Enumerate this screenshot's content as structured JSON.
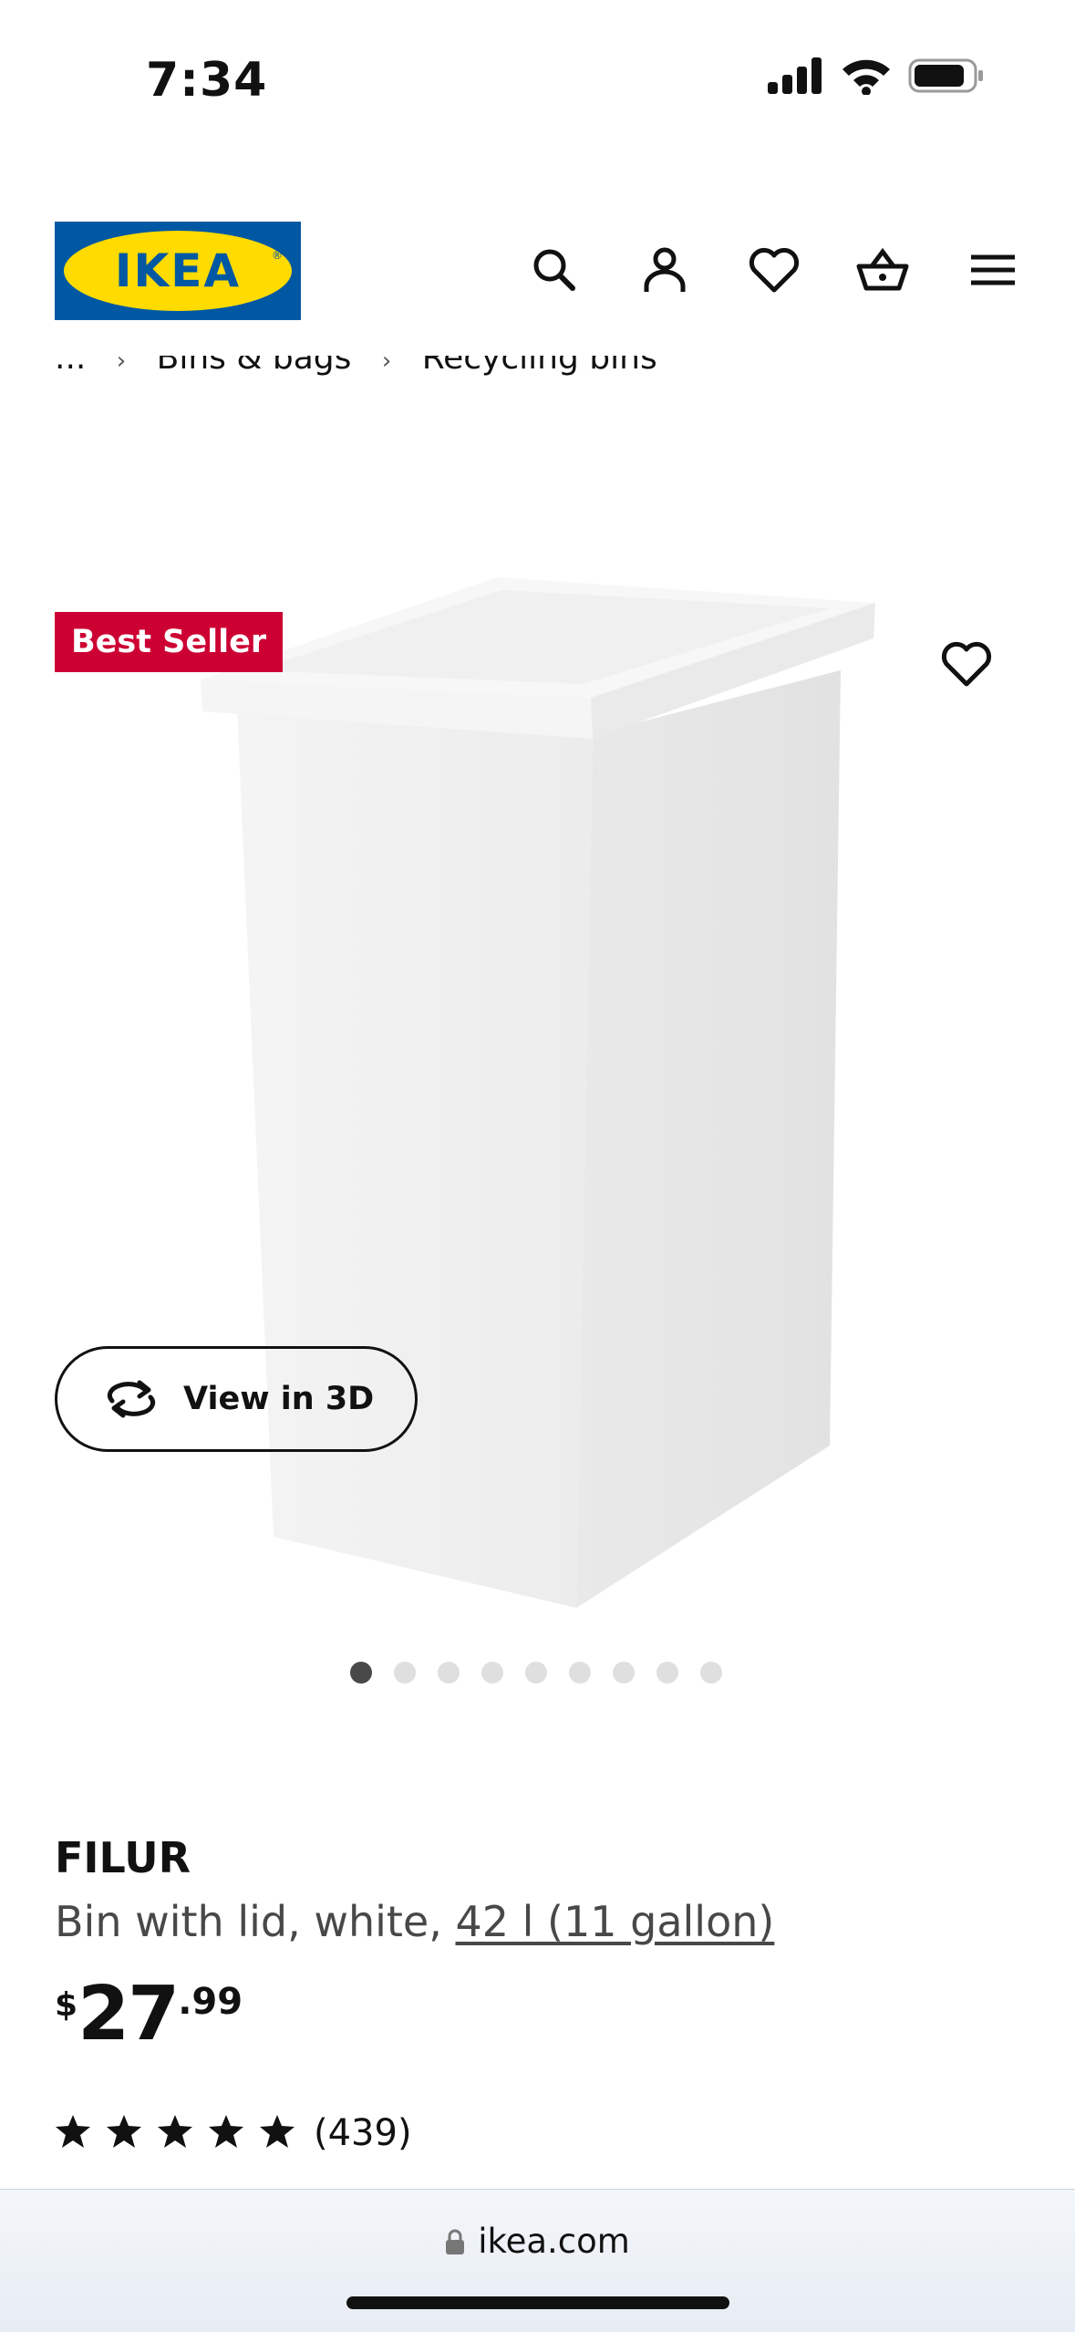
{
  "status_bar": {
    "time": "7:34"
  },
  "header": {
    "logo_text": "IKEA",
    "icons": [
      "search-icon",
      "account-icon",
      "favorites-icon",
      "basket-icon",
      "menu-icon"
    ]
  },
  "breadcrumb": {
    "items": [
      "...",
      "Bins & bags",
      "Recycling bins"
    ],
    "separator": "›"
  },
  "product": {
    "badge": "Best Seller",
    "view_3d_label": "View in 3D",
    "image_count": 9,
    "active_image": 1,
    "name": "FILUR",
    "description": "Bin with lid, white, ",
    "size_link": "42 l (11 gallon)",
    "price": {
      "currency": "$",
      "integer": "27",
      "decimal": ".99"
    },
    "rating_stars": 5,
    "review_count": "(439)"
  },
  "browser": {
    "url": "ikea.com"
  },
  "colors": {
    "ikea_blue": "#0058a3",
    "ikea_yellow": "#ffdb00",
    "badge_red": "#cc0033",
    "text": "#111111",
    "muted_text": "#484848"
  }
}
